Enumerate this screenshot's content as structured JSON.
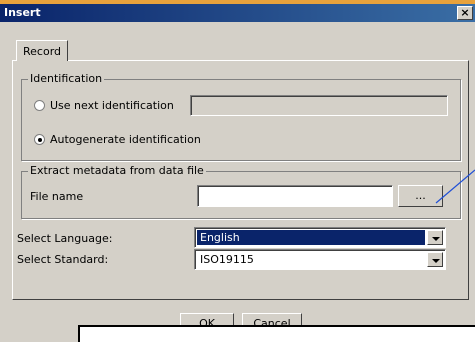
{
  "window": {
    "title": "Insert",
    "close_label": "×"
  },
  "tabs": [
    {
      "label": "Record"
    }
  ],
  "identification": {
    "legend": "Identification",
    "use_next_label": "Use next identification",
    "use_next_value": "",
    "autogenerate_label": "Autogenerate identification",
    "selected": "autogenerate"
  },
  "extract": {
    "legend": "Extract metadata from data file",
    "file_label": "File name",
    "file_value": "",
    "browse_label": "..."
  },
  "language": {
    "label": "Select Language:",
    "value": "English"
  },
  "standard": {
    "label": "Select Standard:",
    "value": "ISO19115"
  },
  "buttons": {
    "ok": "OK",
    "cancel": "Cancel"
  },
  "tooltip": {
    "text": ""
  },
  "colors": {
    "titlebar": "#0a246a",
    "dialog": "#d4d0c8",
    "accent_strip": "#e8a23c",
    "annotation_line": "#1f4fd6"
  }
}
